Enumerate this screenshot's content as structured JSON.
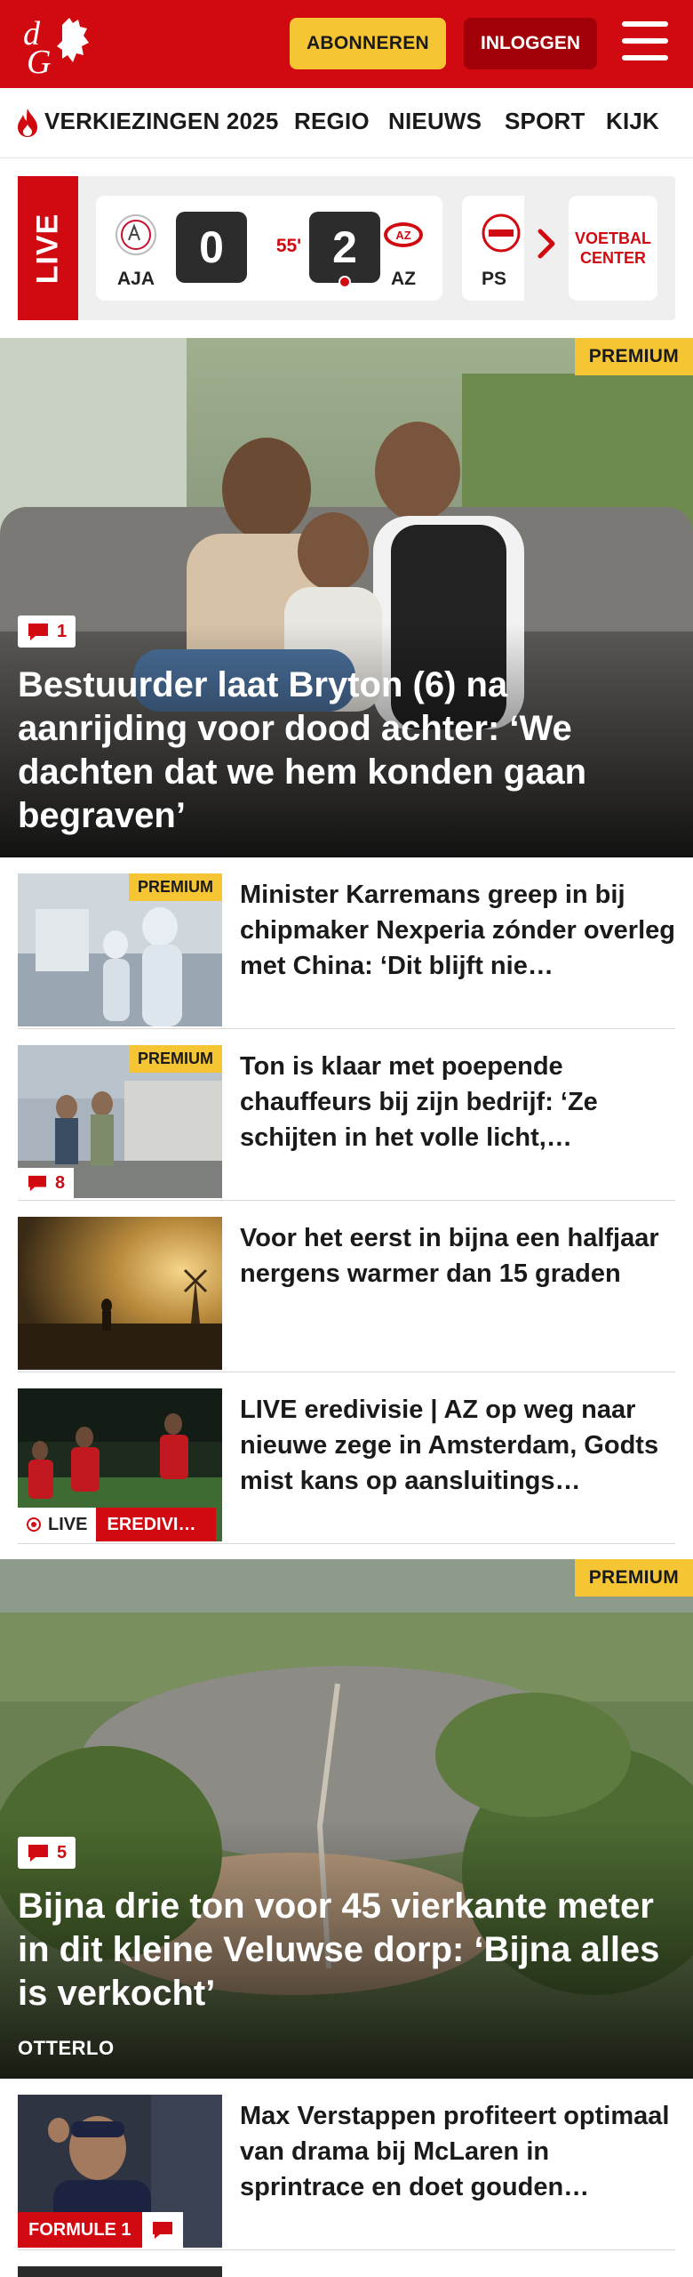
{
  "header": {
    "logo_text": "dG",
    "subscribe_label": "ABONNEREN",
    "login_label": "INLOGGEN",
    "colors": {
      "brand": "#d10a11",
      "accent": "#f5c534",
      "dark_red": "#a10008"
    }
  },
  "nav": {
    "items": [
      {
        "label": "VERKIEZINGEN 2025",
        "icon": "flame-icon"
      },
      {
        "label": "REGIO"
      },
      {
        "label": "NIEUWS"
      },
      {
        "label": "SPORT"
      },
      {
        "label": "KIJK"
      }
    ]
  },
  "live": {
    "badge": "LIVE",
    "match": {
      "home": "AJA",
      "away": "AZ",
      "home_score": "0",
      "away_score": "2",
      "minute": "55'"
    },
    "next_team": "PS",
    "voetbal_center": "VOETBAL CENTER"
  },
  "hero1": {
    "premium": "PREMIUM",
    "comments": "1",
    "title": "Bestuurder laat Bryton (6) na aanrijding voor dood achter: ‘We dachten dat we hem konden gaan begraven’"
  },
  "list1": [
    {
      "title": "Minister Karremans greep in bij chipmaker Nexperia zónder overleg met China: ‘Dit blijft nie…",
      "premium": "PREMIUM"
    },
    {
      "title": "Ton is klaar met poepende chauffeurs bij zijn bedrijf: ‘Ze schijten in het volle licht,…",
      "premium": "PREMIUM",
      "comments": "8"
    },
    {
      "title": "Voor het eerst in bijna een halfjaar nergens warmer dan 15 graden"
    },
    {
      "title": "LIVE eredivisie | AZ op weg naar nieuwe zege in Amsterdam, Godts mist kans op aansluitings…",
      "live": "LIVE",
      "category": "EREDIVI…"
    }
  ],
  "hero2": {
    "premium": "PREMIUM",
    "comments": "5",
    "title": "Bijna drie ton voor 45 vierkante meter in dit kleine Veluwse dorp: ‘Bijna alles is verkocht’",
    "kicker": "OTTERLO"
  },
  "list2": [
    {
      "title": "Max Verstappen profiteert optimaal van drama bij McLaren in sprintrace en doet gouden…",
      "category": "FORMULE 1"
    }
  ]
}
